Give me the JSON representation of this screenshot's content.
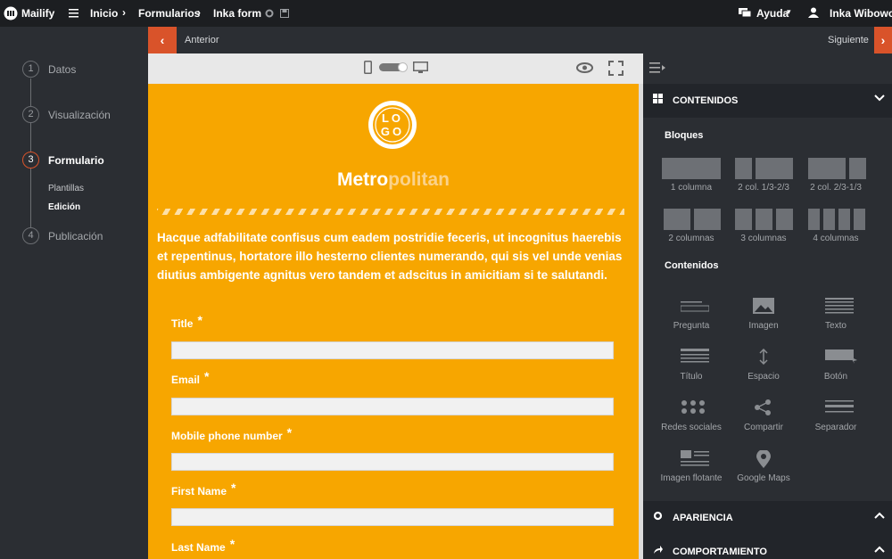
{
  "topbar": {
    "brand": "Mailify",
    "breadcrumb": [
      "Inicio",
      "Formularios",
      "Inka form"
    ],
    "help": "Ayuda",
    "user": "Inka Wibowo"
  },
  "steps": [
    {
      "num": "1",
      "label": "Datos"
    },
    {
      "num": "2",
      "label": "Visualización"
    },
    {
      "num": "3",
      "label": "Formulario"
    },
    {
      "num": "4",
      "label": "Publicación"
    }
  ],
  "substeps": [
    "Plantillas",
    "Edición"
  ],
  "nav": {
    "prev": "Anterior",
    "next": "Siguiente"
  },
  "canvas": {
    "logo_top": "LO",
    "logo_bottom": "GO",
    "brand_a": "Metro",
    "brand_b": "politan",
    "paragraph": "Hacque adfabilitate confisus cum eadem postridie feceris, ut incognitus haerebis et repentinus, hortatore illo hesterno clientes numerando, qui sis vel unde venias diutius ambigente agnitus vero tandem et adscitus in amicitiam si te salutandi.",
    "fields": [
      "Title",
      "Email",
      "Mobile phone number",
      "First Name",
      "Last Name"
    ],
    "required_mark": "*"
  },
  "panel": {
    "contents_title": "CONTENIDOS",
    "blocks_title": "Bloques",
    "blocks": [
      "1 columna",
      "2 col. 1/3-2/3",
      "2 col. 2/3-1/3",
      "2 columnas",
      "3 columnas",
      "4 columnas"
    ],
    "contents_sub": "Contenidos",
    "items": [
      "Pregunta",
      "Imagen",
      "Texto",
      "Título",
      "Espacio",
      "Botón",
      "Redes sociales",
      "Compartir",
      "Separador",
      "Imagen flotante",
      "Google Maps"
    ],
    "appearance": "APARIENCIA",
    "behavior": "COMPORTAMIENTO"
  },
  "colors": {
    "accent": "#d9532a",
    "canvas": "#f7a600"
  }
}
